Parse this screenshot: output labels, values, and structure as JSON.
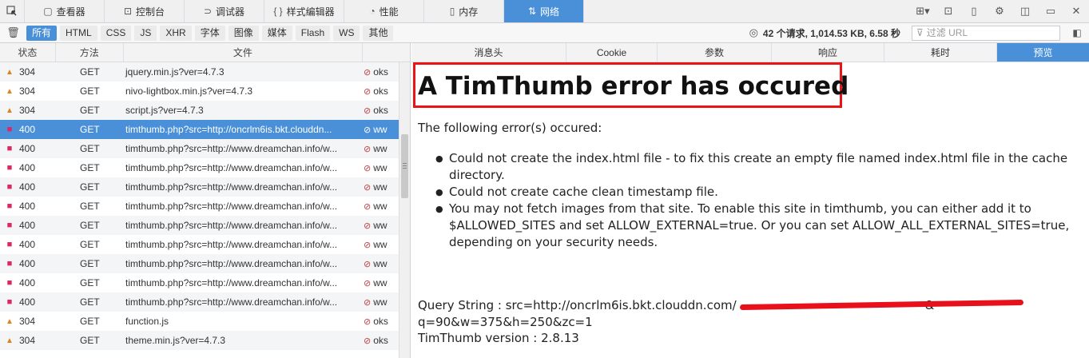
{
  "toolbar": {
    "tabs": [
      {
        "label": "查看器",
        "icon": "inspector-icon",
        "glyph": "▢"
      },
      {
        "label": "控制台",
        "icon": "console-icon",
        "glyph": "⊡"
      },
      {
        "label": "调试器",
        "icon": "debugger-icon",
        "glyph": "⊃"
      },
      {
        "label": "样式编辑器",
        "icon": "style-editor-icon",
        "glyph": "{ }"
      },
      {
        "label": "性能",
        "icon": "performance-icon",
        "glyph": "◔"
      },
      {
        "label": "内存",
        "icon": "memory-icon",
        "glyph": "▯"
      },
      {
        "label": "网络",
        "icon": "network-icon",
        "glyph": "⇅"
      }
    ],
    "active_tab": "网络",
    "right_icons": [
      "responsive-mode-icon",
      "split-console-icon",
      "device-icon",
      "settings-icon",
      "dock-icon",
      "undock-icon",
      "close-icon"
    ]
  },
  "filters": {
    "types": [
      "所有",
      "HTML",
      "CSS",
      "JS",
      "XHR",
      "字体",
      "图像",
      "媒体",
      "Flash",
      "WS",
      "其他"
    ],
    "active": "所有",
    "summary": "42 个请求, 1,014.53 KB, 6.58 秒",
    "url_placeholder": "过滤 URL"
  },
  "list": {
    "headers": {
      "status": "状态",
      "method": "方法",
      "file": "文件"
    },
    "rows": [
      {
        "status": "304",
        "kind": "warn",
        "method": "GET",
        "file": "jquery.min.js?ver=4.7.3",
        "domain": "oks"
      },
      {
        "status": "304",
        "kind": "warn",
        "method": "GET",
        "file": "nivo-lightbox.min.js?ver=4.7.3",
        "domain": "oks"
      },
      {
        "status": "304",
        "kind": "warn",
        "method": "GET",
        "file": "script.js?ver=4.7.3",
        "domain": "oks"
      },
      {
        "status": "400",
        "kind": "err",
        "method": "GET",
        "file": "timthumb.php?src=http://oncrlm6is.bkt.clouddn...",
        "domain": "ww",
        "selected": true
      },
      {
        "status": "400",
        "kind": "err",
        "method": "GET",
        "file": "timthumb.php?src=http://www.dreamchan.info/w...",
        "domain": "ww"
      },
      {
        "status": "400",
        "kind": "err",
        "method": "GET",
        "file": "timthumb.php?src=http://www.dreamchan.info/w...",
        "domain": "ww"
      },
      {
        "status": "400",
        "kind": "err",
        "method": "GET",
        "file": "timthumb.php?src=http://www.dreamchan.info/w...",
        "domain": "ww"
      },
      {
        "status": "400",
        "kind": "err",
        "method": "GET",
        "file": "timthumb.php?src=http://www.dreamchan.info/w...",
        "domain": "ww"
      },
      {
        "status": "400",
        "kind": "err",
        "method": "GET",
        "file": "timthumb.php?src=http://www.dreamchan.info/w...",
        "domain": "ww"
      },
      {
        "status": "400",
        "kind": "err",
        "method": "GET",
        "file": "timthumb.php?src=http://www.dreamchan.info/w...",
        "domain": "ww"
      },
      {
        "status": "400",
        "kind": "err",
        "method": "GET",
        "file": "timthumb.php?src=http://www.dreamchan.info/w...",
        "domain": "ww"
      },
      {
        "status": "400",
        "kind": "err",
        "method": "GET",
        "file": "timthumb.php?src=http://www.dreamchan.info/w...",
        "domain": "ww"
      },
      {
        "status": "400",
        "kind": "err",
        "method": "GET",
        "file": "timthumb.php?src=http://www.dreamchan.info/w...",
        "domain": "ww"
      },
      {
        "status": "304",
        "kind": "warn",
        "method": "GET",
        "file": "function.js",
        "domain": "oks"
      },
      {
        "status": "304",
        "kind": "warn",
        "method": "GET",
        "file": "theme.min.js?ver=4.7.3",
        "domain": "oks"
      }
    ]
  },
  "details": {
    "tabs": [
      "消息头",
      "Cookie",
      "参数",
      "响应",
      "耗时",
      "预览"
    ],
    "active_tab": "预览",
    "preview": {
      "title": "A TimThumb error has occured",
      "intro": "The following error(s) occured:",
      "errors": [
        "Could not create the index.html file - to fix this create an empty file named index.html file in the cache directory.",
        "Could not create cache clean timestamp file.",
        "You may not fetch images from that site. To enable this site in timthumb, you can either add it to $ALLOWED_SITES and set ALLOW_EXTERNAL=true. Or you can set ALLOW_ALL_EXTERNAL_SITES=true, depending on your security needs."
      ],
      "query_line1": "Query String : src=http://oncrlm6is.bkt.clouddn.com/",
      "query_line1_tail": "&",
      "query_line2": "q=90&w=375&h=250&zc=1",
      "version": "TimThumb version : 2.8.13"
    }
  },
  "colors": {
    "accent": "#4a90d9",
    "warn": "#e0801f",
    "error": "#e0265c",
    "highlight": "#e81416"
  }
}
